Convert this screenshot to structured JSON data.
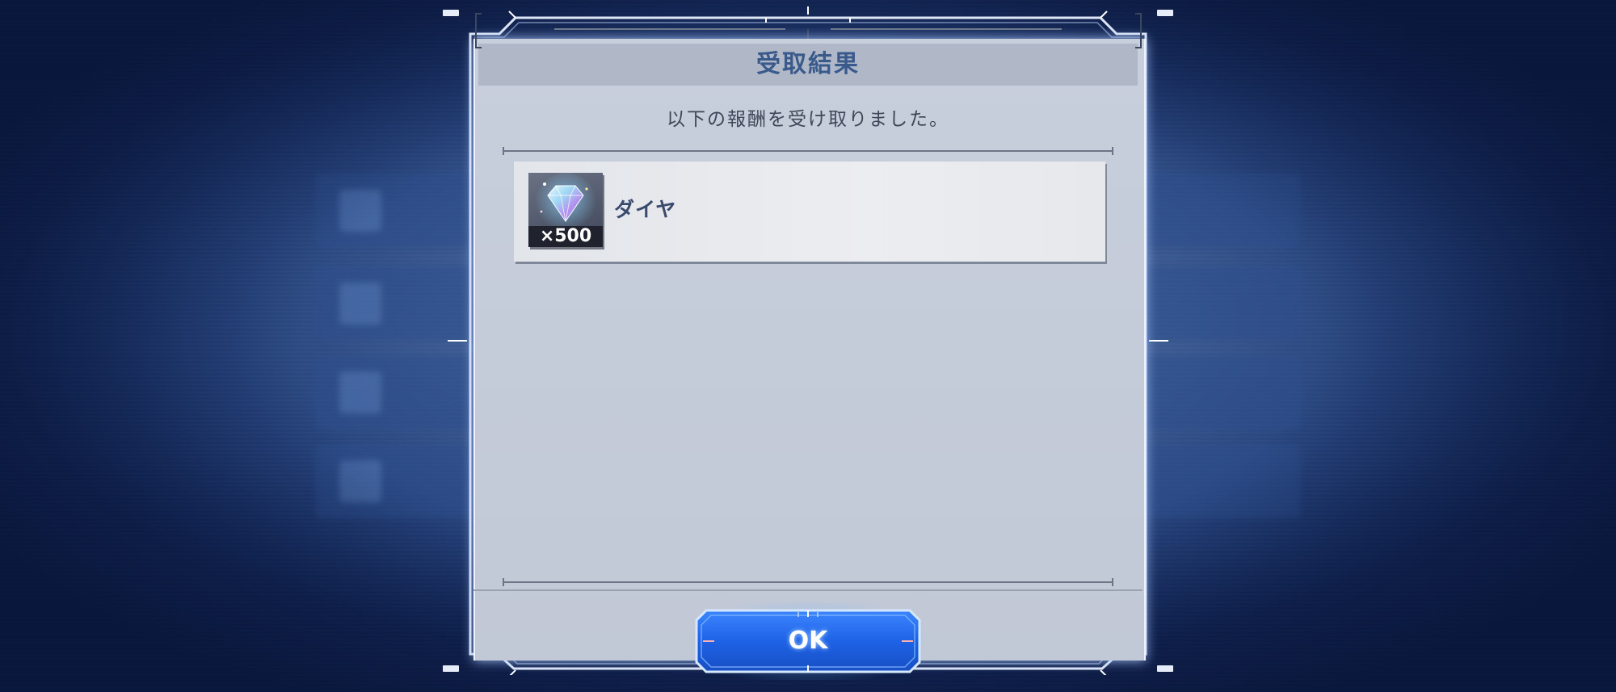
{
  "dialog": {
    "title": "受取結果",
    "message": "以下の報酬を受け取りました。"
  },
  "rewards": [
    {
      "name": "ダイヤ",
      "quantity": "×500",
      "icon": "diamond-icon"
    }
  ],
  "buttons": {
    "ok_label": "OK"
  },
  "colors": {
    "accent": "#2a6cf0",
    "title_text": "#3a5a8c",
    "panel_bg": "#c8cfdc"
  }
}
